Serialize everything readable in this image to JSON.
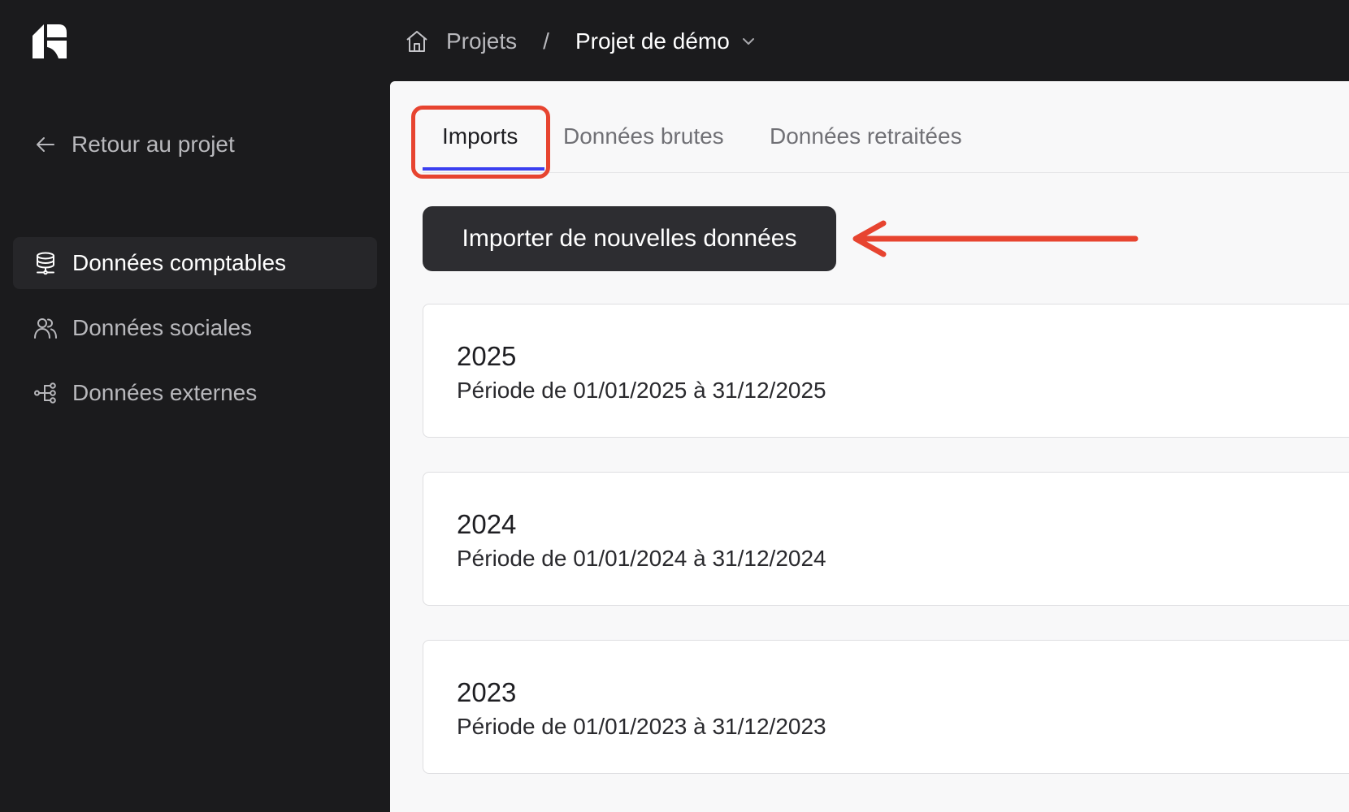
{
  "header": {
    "breadcrumb": {
      "home_icon": "home-icon",
      "projects": "Projets",
      "separator": "/",
      "current_project": "Projet de démo",
      "dropdown_icon": "chevron-down-icon"
    }
  },
  "sidebar": {
    "back": {
      "icon": "arrow-left-icon",
      "label": "Retour au projet"
    },
    "items": [
      {
        "label": "Données comptables",
        "icon": "database-icon",
        "active": true
      },
      {
        "label": "Données sociales",
        "icon": "users-icon",
        "active": false
      },
      {
        "label": "Données externes",
        "icon": "connector-icon",
        "active": false
      }
    ]
  },
  "main": {
    "tabs": [
      {
        "label": "Imports",
        "active": true
      },
      {
        "label": "Données brutes",
        "active": false
      },
      {
        "label": "Données retraitées",
        "active": false
      }
    ],
    "import_button": "Importer de nouvelles données",
    "periods": [
      {
        "year": "2025",
        "period": "Période de 01/01/2025 à 31/12/2025"
      },
      {
        "year": "2024",
        "period": "Période de 01/01/2024 à 31/12/2024"
      },
      {
        "year": "2023",
        "period": "Période de 01/01/2023 à 31/12/2023"
      }
    ]
  },
  "annotations": {
    "highlight_color": "#e74430",
    "arrow_color": "#e74430"
  },
  "colors": {
    "sidebar_bg": "#1b1b1d",
    "tab_active_underline": "#3b3ff0",
    "button_bg": "#2d2d31"
  }
}
